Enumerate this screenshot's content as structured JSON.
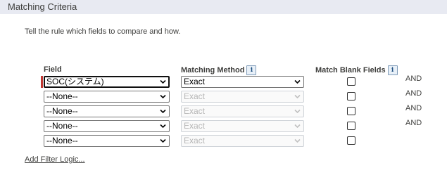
{
  "section": {
    "title": "Matching Criteria"
  },
  "intro_text": "Tell the rule which fields to compare and how.",
  "columns": {
    "field": "Field",
    "matching_method": "Matching Method",
    "match_blank_fields": "Match Blank Fields"
  },
  "info_glyph": "i",
  "rows": [
    {
      "field": "SOC(システム)",
      "method": "Exact",
      "method_disabled": false,
      "match_blank": false,
      "conjunction": "AND",
      "required": true
    },
    {
      "field": "--None--",
      "method": "Exact",
      "method_disabled": true,
      "match_blank": false,
      "conjunction": "AND",
      "required": false
    },
    {
      "field": "--None--",
      "method": "Exact",
      "method_disabled": true,
      "match_blank": false,
      "conjunction": "AND",
      "required": false
    },
    {
      "field": "--None--",
      "method": "Exact",
      "method_disabled": true,
      "match_blank": false,
      "conjunction": "AND",
      "required": false
    },
    {
      "field": "--None--",
      "method": "Exact",
      "method_disabled": true,
      "match_blank": false,
      "conjunction": "",
      "required": false
    }
  ],
  "add_filter_logic": "Add Filter Logic...",
  "colors": {
    "header_bg": "#e8eaf2",
    "required_bar": "#c23934",
    "disabled_text": "#b6b6b6"
  }
}
